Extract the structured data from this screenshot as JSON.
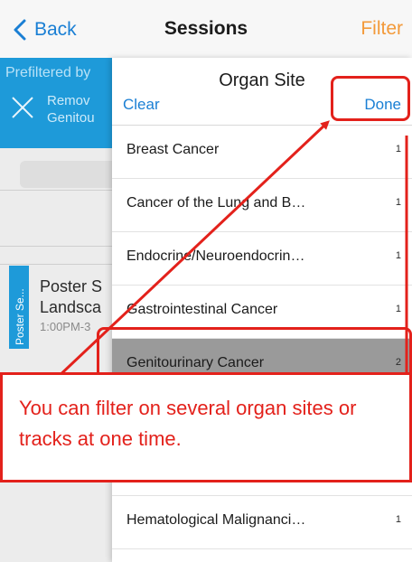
{
  "nav": {
    "back_label": "Back",
    "title": "Sessions",
    "filter_label": "Filter"
  },
  "background": {
    "prefilter_label": "Prefiltered by",
    "remove_line1": "Remov",
    "remove_line2": "Genitou",
    "poster_tab_label": "Poster Se...",
    "poster_title_line1": "Poster S",
    "poster_title_line2": "Landsca",
    "poster_time": "1:00PM-3"
  },
  "panel": {
    "title": "Organ Site",
    "clear_label": "Clear",
    "done_label": "Done",
    "sites": [
      {
        "name": "Breast Cancer",
        "count": "1",
        "selected": false
      },
      {
        "name": "Cancer of the Lung and B…",
        "count": "1",
        "selected": false
      },
      {
        "name": "Endocrine/Neuroendocrin…",
        "count": "1",
        "selected": false
      },
      {
        "name": "Gastrointestinal Cancer",
        "count": "1",
        "selected": false
      },
      {
        "name": "Genitourinary Cancer",
        "count": "2",
        "selected": true
      },
      {
        "name": "Hematological Malignanci…",
        "count": "1",
        "selected": false
      }
    ]
  },
  "annotation": {
    "text": "You can filter on several organ sites or tracks at one time."
  },
  "colors": {
    "accent_blue": "#1a7fd4",
    "filter_orange": "#f39a3a",
    "annotation_red": "#e3211b",
    "selected_gray": "#9a9a9a"
  }
}
